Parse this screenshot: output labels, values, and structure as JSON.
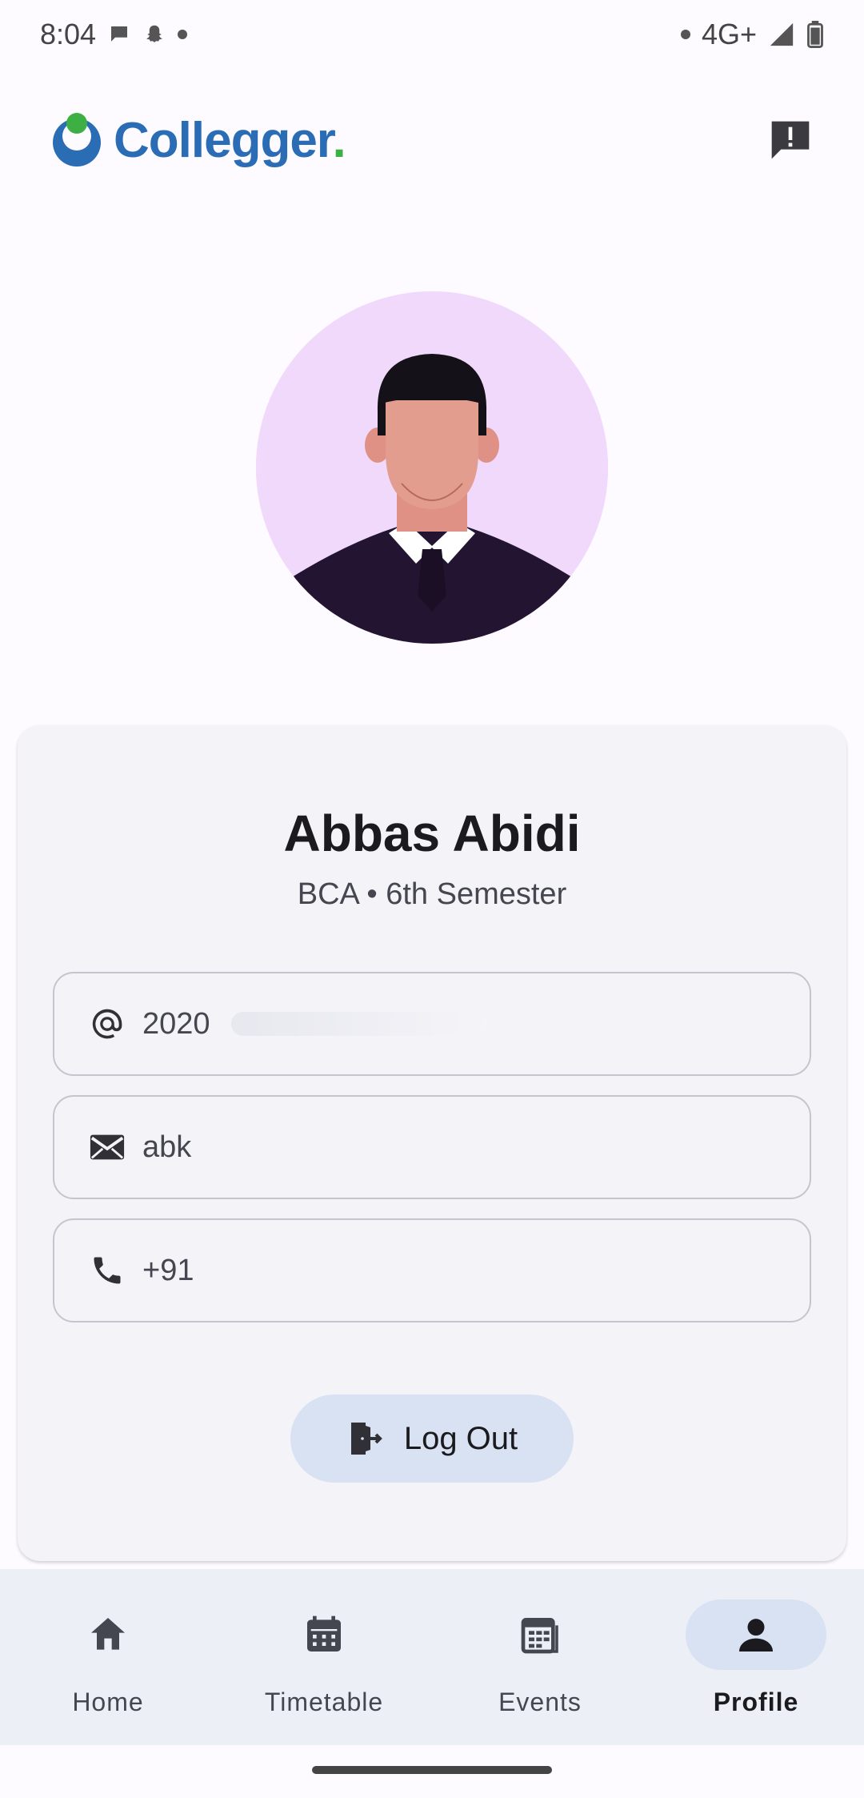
{
  "status_bar": {
    "time": "8:04",
    "network": "4G+",
    "icons": [
      "chat-bubble-icon",
      "snapchat-icon",
      "dot-icon",
      "signal-icon",
      "battery-icon"
    ]
  },
  "app_bar": {
    "logo_text": "Collegger",
    "logo_period": ".",
    "feedback_icon": "feedback-icon"
  },
  "profile": {
    "name": "Abbas Abidi",
    "subtitle": "BCA • 6th Semester",
    "fields": {
      "id": {
        "icon": "at-icon",
        "value": "2020"
      },
      "email": {
        "icon": "mail-icon",
        "value": "abk"
      },
      "phone": {
        "icon": "phone-icon",
        "value": "+91"
      }
    },
    "logout_label": "Log Out"
  },
  "bottom_nav": {
    "items": [
      {
        "label": "Home",
        "icon": "home-icon",
        "active": false
      },
      {
        "label": "Timetable",
        "icon": "calendar-icon",
        "active": false
      },
      {
        "label": "Events",
        "icon": "events-icon",
        "active": false
      },
      {
        "label": "Profile",
        "icon": "person-icon",
        "active": true
      }
    ]
  },
  "colors": {
    "brand_blue": "#2a6db5",
    "brand_green": "#3cb043",
    "avatar_bg": "#f1d9fb",
    "active_pill": "#d8e2f3"
  }
}
